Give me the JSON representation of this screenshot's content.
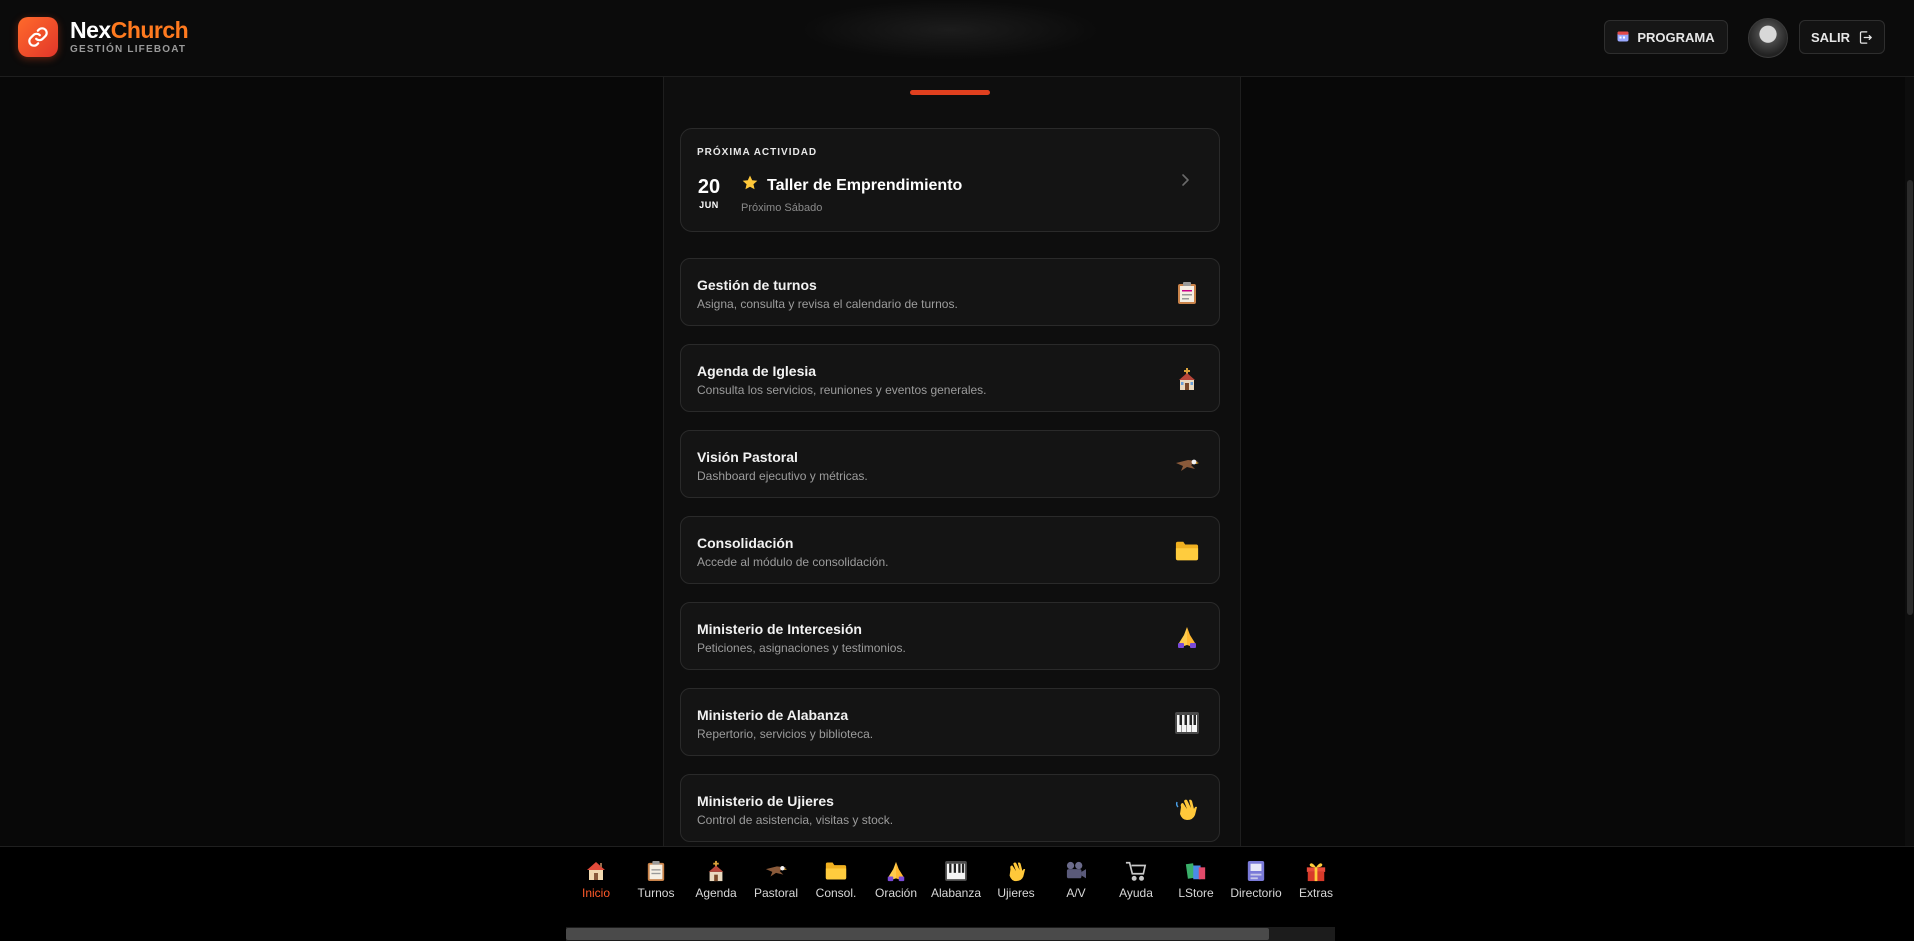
{
  "brand": {
    "name_part1": "Nex",
    "name_part2": "Church",
    "subtitle": "GESTIÓN LIFEBOAT"
  },
  "header": {
    "programa_label": "PROGRAMA",
    "salir_label": "SALIR"
  },
  "next_activity": {
    "label": "PRÓXIMA ACTIVIDAD",
    "day": "20",
    "month": "JUN",
    "title": "Taller de Emprendimiento",
    "subtitle": "Próximo Sábado"
  },
  "modules": [
    {
      "title": "Gestión de turnos",
      "desc": "Asigna, consulta y revisa el calendario de turnos.",
      "icon": "clipboard-icon"
    },
    {
      "title": "Agenda de Iglesia",
      "desc": "Consulta los servicios, reuniones y eventos generales.",
      "icon": "church-icon"
    },
    {
      "title": "Visión Pastoral",
      "desc": "Dashboard ejecutivo y métricas.",
      "icon": "eagle-icon"
    },
    {
      "title": "Consolidación",
      "desc": "Accede al módulo de consolidación.",
      "icon": "folder-icon"
    },
    {
      "title": "Ministerio de Intercesión",
      "desc": "Peticiones, asignaciones y testimonios.",
      "icon": "praying-hands-icon"
    },
    {
      "title": "Ministerio de Alabanza",
      "desc": "Repertorio, servicios y biblioteca.",
      "icon": "piano-icon"
    },
    {
      "title": "Ministerio de Ujieres",
      "desc": "Control de asistencia, visitas y stock.",
      "icon": "waving-hand-icon"
    }
  ],
  "bottom_nav": [
    {
      "label": "Inicio",
      "icon": "house-icon",
      "active": true
    },
    {
      "label": "Turnos",
      "icon": "clipboard-icon"
    },
    {
      "label": "Agenda",
      "icon": "church-icon"
    },
    {
      "label": "Pastoral",
      "icon": "eagle-icon"
    },
    {
      "label": "Consol.",
      "icon": "folder-icon"
    },
    {
      "label": "Oración",
      "icon": "praying-hands-icon"
    },
    {
      "label": "Alabanza",
      "icon": "piano-icon"
    },
    {
      "label": "Ujieres",
      "icon": "waving-hand-icon"
    },
    {
      "label": "A/V",
      "icon": "video-camera-icon"
    },
    {
      "label": "Ayuda",
      "icon": "cart-icon"
    },
    {
      "label": "LStore",
      "icon": "books-icon"
    },
    {
      "label": "Directorio",
      "icon": "address-book-icon"
    },
    {
      "label": "Extras",
      "icon": "gift-icon"
    }
  ],
  "colors": {
    "accent": "#ff7a1f",
    "accent_red": "#e0401f",
    "background": "#080808",
    "card": "#141414"
  }
}
